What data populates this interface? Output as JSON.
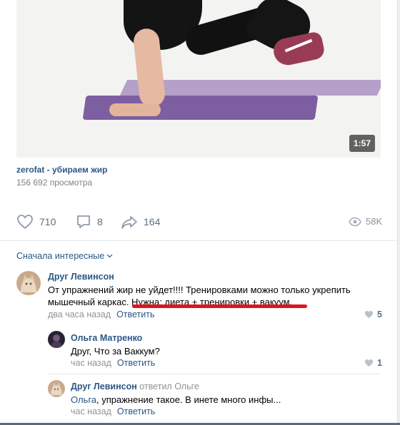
{
  "video": {
    "duration": "1:57",
    "title": "zerofat - убираем жир",
    "views": "156 692 просмотра"
  },
  "actions": {
    "likes": "710",
    "comments": "8",
    "shares": "164",
    "views": "58K"
  },
  "sort_label": "Сначала интересные",
  "comments": [
    {
      "author": "Друг Левинсон",
      "text_line1": "От упражнений жир не уйдет!!!! Тренировками можно только укрепить",
      "text_line2_a": "мышечный каркас.",
      "text_line2_b": " Нужна: диета + тренировки + вакуум.",
      "time": "два часа назад",
      "reply_label": "Ответить",
      "likes": "5"
    },
    {
      "author": "Ольга Матренко",
      "text": "Друг, Что за Ваккум?",
      "time": "час назад",
      "reply_label": "Ответить",
      "likes": "1"
    },
    {
      "author": "Друг Левинсон",
      "replied_to": "ответил Ольге",
      "mention": "Ольга",
      "text": ", упражнение такое. В инете много инфы...",
      "time": "час назад",
      "reply_label": "Ответить"
    }
  ],
  "colors": {
    "link": "#2a5885",
    "muted": "#939393",
    "highlight": "#e0141f"
  }
}
